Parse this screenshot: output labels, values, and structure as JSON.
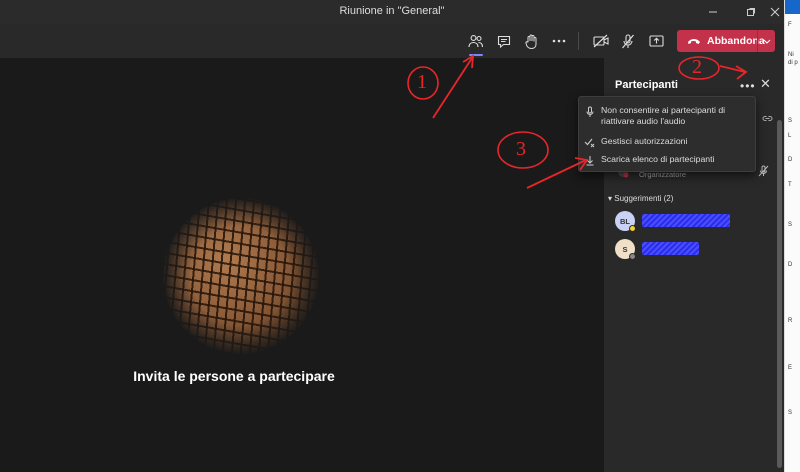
{
  "window": {
    "title": "Riunione in \"General\"",
    "controls": [
      "minimize-icon",
      "maximize-icon",
      "close-icon"
    ]
  },
  "toolbar": {
    "icons": [
      "participants-icon",
      "chat-icon",
      "raise-hand-icon",
      "more-icon",
      "camera-off-icon",
      "mic-off-icon",
      "share-screen-icon"
    ],
    "leave_label": "Abbandona",
    "leave_color": "#c4314b",
    "active_indicator_color": "#7f85f5"
  },
  "stage": {
    "invite_text": "Invita le persone a partecipare"
  },
  "panel": {
    "title": "Partecipanti",
    "organizer": {
      "role": "Organizzatore"
    },
    "suggestions_header": "Suggerimenti (2)",
    "suggestions": [
      {
        "initials": "BL",
        "name": "",
        "status_color": "#f8d22a",
        "avatar_color": "#c9d1f5"
      },
      {
        "initials": "S",
        "name": "",
        "status_color": "#8a8886",
        "avatar_color": "#f0e0c8"
      }
    ]
  },
  "menu": {
    "items": [
      {
        "label": "Non consentire ai partecipanti di riattivare audio l'audio",
        "icon": "mic-icon"
      },
      {
        "label": "Gestisci autorizzazioni",
        "icon": "permissions-icon"
      },
      {
        "label": "Scarica elenco di partecipanti",
        "icon": "download-icon"
      }
    ]
  },
  "annotations": {
    "labels": [
      "1",
      "2",
      "3"
    ],
    "color": "#e8262a"
  },
  "side_strip": {
    "snippets": [
      "F",
      "Ni",
      "di p",
      "S",
      "L",
      "D",
      "T",
      "S",
      "D",
      "R",
      "E",
      "S"
    ]
  }
}
